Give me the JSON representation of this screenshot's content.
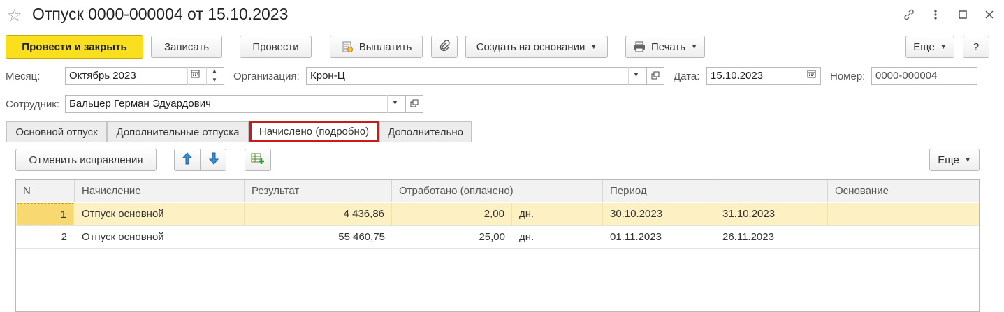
{
  "window": {
    "title": "Отпуск 0000-000004 от 15.10.2023"
  },
  "toolbar": {
    "post_and_close": "Провести и закрыть",
    "save": "Записать",
    "post": "Провести",
    "pay": "Выплатить",
    "create_based_on": "Создать на основании",
    "print": "Печать",
    "more": "Еще",
    "help": "?"
  },
  "form": {
    "month_label": "Месяц:",
    "month_value": "Октябрь 2023",
    "org_label": "Организация:",
    "org_value": "Крон-Ц",
    "date_label": "Дата:",
    "date_value": "15.10.2023",
    "number_label": "Номер:",
    "number_value": "0000-000004",
    "employee_label": "Сотрудник:",
    "employee_value": "Бальцер Герман Эдуардович"
  },
  "tabs": [
    {
      "label": "Основной отпуск"
    },
    {
      "label": "Дополнительные отпуска"
    },
    {
      "label": "Начислено (подробно)"
    },
    {
      "label": "Дополнительно"
    }
  ],
  "accruals_panel": {
    "cancel_corrections": "Отменить исправления",
    "more": "Еще"
  },
  "table": {
    "columns": [
      "N",
      "Начисление",
      "Результат",
      "Отработано (оплачено)",
      "Период",
      "",
      "Основание"
    ],
    "rows": [
      {
        "n": "1",
        "accrual": "Отпуск основной",
        "result": "4 436,86",
        "worked": "2,00",
        "unit": "дн.",
        "period_from": "30.10.2023",
        "period_to": "31.10.2023",
        "basis": ""
      },
      {
        "n": "2",
        "accrual": "Отпуск основной",
        "result": "55 460,75",
        "worked": "25,00",
        "unit": "дн.",
        "period_from": "01.11.2023",
        "period_to": "26.11.2023",
        "basis": ""
      }
    ]
  },
  "colors": {
    "primary_button": "#f9df1e",
    "selected_row": "#fdf1c4",
    "active_tab_border": "#cc1a1a"
  }
}
